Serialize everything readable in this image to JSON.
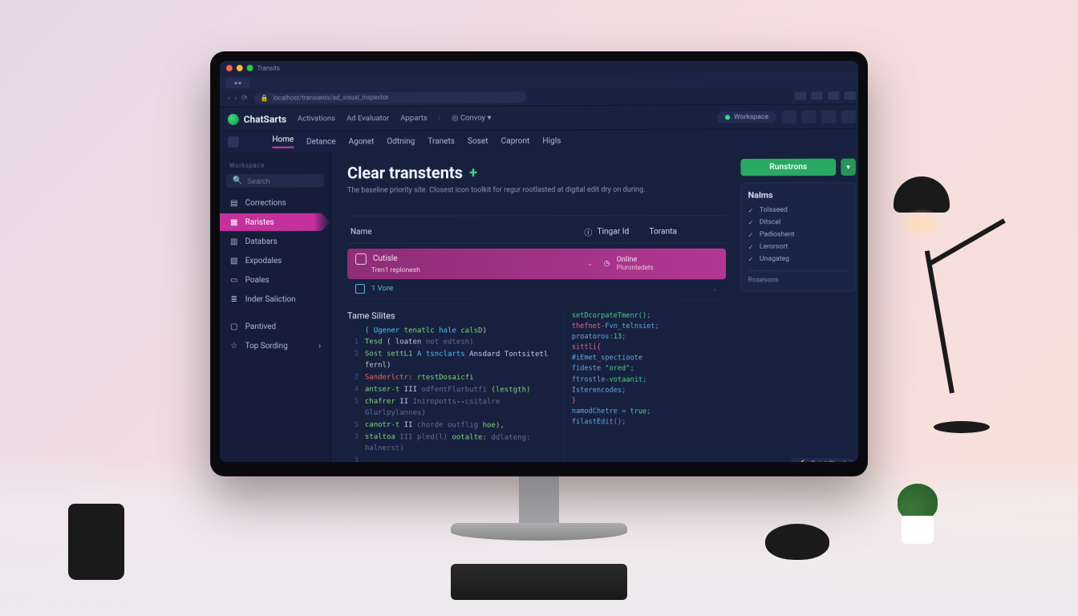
{
  "window": {
    "tab": "Transits",
    "address": "localhost/transients/ad_visual_inspector"
  },
  "brand": "ChatSarts",
  "topMenu": [
    "Activations",
    "Ad Evaluator",
    "Apparts",
    "Convoy"
  ],
  "nav": [
    "Home",
    "Detance",
    "Agonet",
    "Odtning",
    "Tranets",
    "Soset",
    "Capront",
    "Higls"
  ],
  "navActiveIndex": 0,
  "userBadge": "Workspace",
  "side": {
    "groupLabel": "Workspace",
    "searchPlaceholder": "Search",
    "items": [
      {
        "label": "Corrections",
        "icon": "layers-icon"
      },
      {
        "label": "Raristes",
        "icon": "database-icon",
        "active": true
      },
      {
        "label": "Databars",
        "icon": "grid-icon"
      },
      {
        "label": "Expodales",
        "icon": "chart-icon"
      },
      {
        "label": "Poales",
        "icon": "bars-icon"
      },
      {
        "label": "Inder Saliction",
        "icon": "sliders-icon"
      },
      {
        "label": "Pantived",
        "icon": "archive-icon"
      },
      {
        "label": "Top Sording",
        "icon": "star-icon",
        "chev": true
      }
    ]
  },
  "page": {
    "title": "Clear transtents",
    "subtitle": "The baseline priority site. Closest icon toolkit for regur rootlasted at digital edit dry on during.",
    "cols": [
      "Name",
      "Tingar Id",
      "Toranta"
    ],
    "row": {
      "name": "Cutisle",
      "subtitle": "Tren1 replonesh",
      "statIcon": "clock-icon",
      "statLabel": "Online",
      "statSub": "Plurontedets"
    },
    "row2": "1 Vore"
  },
  "codeTitle": "Tame Silites",
  "codeLeft": [
    {
      "n": "",
      "tokens": [
        [
          "kw",
          "( Ugener"
        ],
        [
          "fn",
          " tenatlc "
        ],
        [
          "kw",
          "hale "
        ],
        [
          "fn",
          "calsD"
        ],
        [
          "",
          ")"
        ]
      ]
    },
    {
      "n": "1",
      "tokens": [
        [
          "fn",
          "Tesd "
        ],
        [
          "",
          "( loaten "
        ],
        [
          "cm",
          "not edtesh)"
        ]
      ]
    },
    {
      "n": "2",
      "tokens": [
        [
          "fn",
          "Sost settL1  "
        ],
        [
          "kw",
          "A  tsnclarts"
        ],
        [
          "",
          "  Ansdard Tontsitetl fernl)"
        ]
      ]
    },
    {
      "n": "2",
      "tokens": [
        [
          "err",
          "Sanderlctr: "
        ],
        [
          "fn",
          "rtestDosaicfi"
        ]
      ]
    },
    {
      "n": "4",
      "tokens": [
        [
          "fn",
          "antser-t "
        ],
        [
          "",
          "III   "
        ],
        [
          "cm",
          "odfentFlurbutfi"
        ],
        [
          "fn",
          "  (lestgth)"
        ]
      ]
    },
    {
      "n": "5",
      "tokens": [
        [
          "fn",
          "chafrer "
        ],
        [
          "",
          "II  "
        ],
        [
          "cm",
          "Iniropotts"
        ],
        [
          "",
          "--"
        ],
        [
          "cm",
          "csitalre  Glurlpylannes)"
        ]
      ]
    },
    {
      "n": "5",
      "tokens": [
        [
          "fn",
          "canotr-t "
        ],
        [
          "",
          "II  "
        ],
        [
          "cm",
          "chorde outflig"
        ],
        [
          "fn",
          " hoe),"
        ]
      ]
    },
    {
      "n": "3",
      "tokens": [
        [
          "fn",
          "staltoa "
        ],
        [
          "cm",
          "III  pled(l)"
        ],
        [
          "fn",
          "  ootalte: "
        ],
        [
          "cm",
          "ddlateng: halnerst)"
        ]
      ]
    },
    {
      "n": "3",
      "tokens": [
        [
          "",
          ""
        ]
      ]
    }
  ],
  "codeRight": [
    "<g>setDcorpateTmenr()</g>;",
    "<r>thefnet-</r><b>Fvn_telnsiet</b>;",
    "<b>proatoros</b>:<g>13</g>;",
    "",
    "<r>sittli{</r>",
    "  <b>#iEmet_spectioote</b>",
    "  <b>fideste</b> <g>\"ored\"</g>;",
    "  <b>ftrostle</b>-<g>votaanit</g>;",
    "  <b>Isterencodes</b>;",
    "<r>}</r>",
    "<b>namodChetre</b> = <g>true</g>;",
    "<b>filastEdit</b>();"
  ],
  "rightBtn": "Runstrons",
  "panelTitle": "Nalms",
  "checks": [
    "Tolsseed",
    "Ditscel",
    "Padioshent",
    "Lerorsort",
    "Unagateg"
  ],
  "panelFooter": "Rosesons",
  "rightPillLabel": "QuickCheck"
}
